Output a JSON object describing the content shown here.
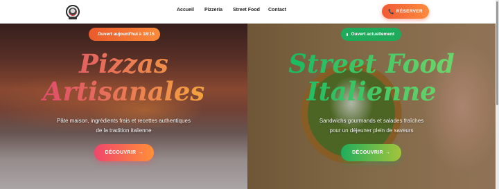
{
  "header": {
    "logo_icon": "restaurant-logo-icon",
    "nav": [
      "Accueil",
      "Pizzeria",
      "Street Food",
      "Contact"
    ],
    "reserve_label": "RÉSERVER",
    "reserve_icon": "phone-icon"
  },
  "left": {
    "badge": "Ouvert aujourd'hui à 18:15",
    "title_line1": "Pizzas",
    "title_line2": "Artisanales",
    "desc_line1": "Pâte maison, ingrédients frais et recettes authentiques",
    "desc_line2": "de la tradition italienne",
    "cta_label": "DÉCOUVRIR",
    "cta_arrow": "→"
  },
  "right": {
    "badge": "Ouvert actuellement",
    "title_line1": "Street Food",
    "title_line2": "Italienne",
    "desc_line1": "Sandwichs gourmands et salades fraîches",
    "desc_line2": "pour un déjeuner plein de saveurs",
    "cta_label": "DÉCOUVRIR",
    "cta_arrow": "→"
  },
  "colors": {
    "accent_orange": "#f05a36",
    "accent_green": "#1fab5b",
    "accent_pink": "#e0506a"
  }
}
